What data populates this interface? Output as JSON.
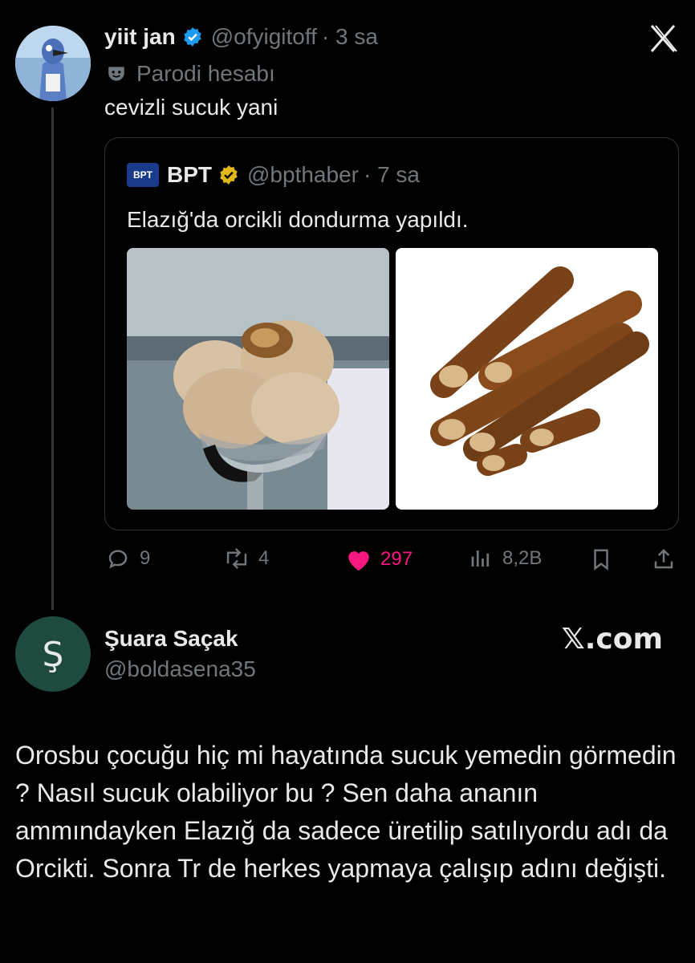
{
  "tweet": {
    "display_name": "yiit jan",
    "handle": "@ofyigitoff",
    "time": "· 3 sa",
    "parody_label": "Parodi hesabı",
    "text": "cevizli sucuk yani",
    "icons": [
      "verified-badge-icon",
      "parody-mask-icon",
      "close-icon"
    ]
  },
  "quoted": {
    "logo_text": "BPT",
    "display_name": "BPT",
    "handle": "@bpthaber",
    "time": "· 7 sa",
    "text": "Elazığ'da orcikli dondurma yapıldı.",
    "images": [
      "ice-cream-cup-photo",
      "walnut-sausage-orcik-photo"
    ]
  },
  "actions": {
    "replies": "9",
    "reposts": "4",
    "likes": "297",
    "views": "8,2B",
    "colors": {
      "like": "#f91880",
      "default": "#71767b"
    }
  },
  "reply": {
    "avatar_letter": "Ş",
    "display_name": "Şuara Saçak",
    "handle": "@boldasena35",
    "watermark": "𝕏.com",
    "text": "Orosbu çocuğu hiç mi hayatında sucuk yemedin görmedin ? Nasıl sucuk olabiliyor bu ? Sen daha ananın ammındayken Elazığ da sadece üretilip satılıyordu adı da Orcikti. Sonra Tr de herkes yapmaya çalışıp adını değişti."
  },
  "theme": {
    "background": "#000000",
    "text": "#e7e9ea",
    "muted": "#71767b",
    "verified_blue": "#1d9bf0",
    "verified_gold": "#e2b719"
  }
}
